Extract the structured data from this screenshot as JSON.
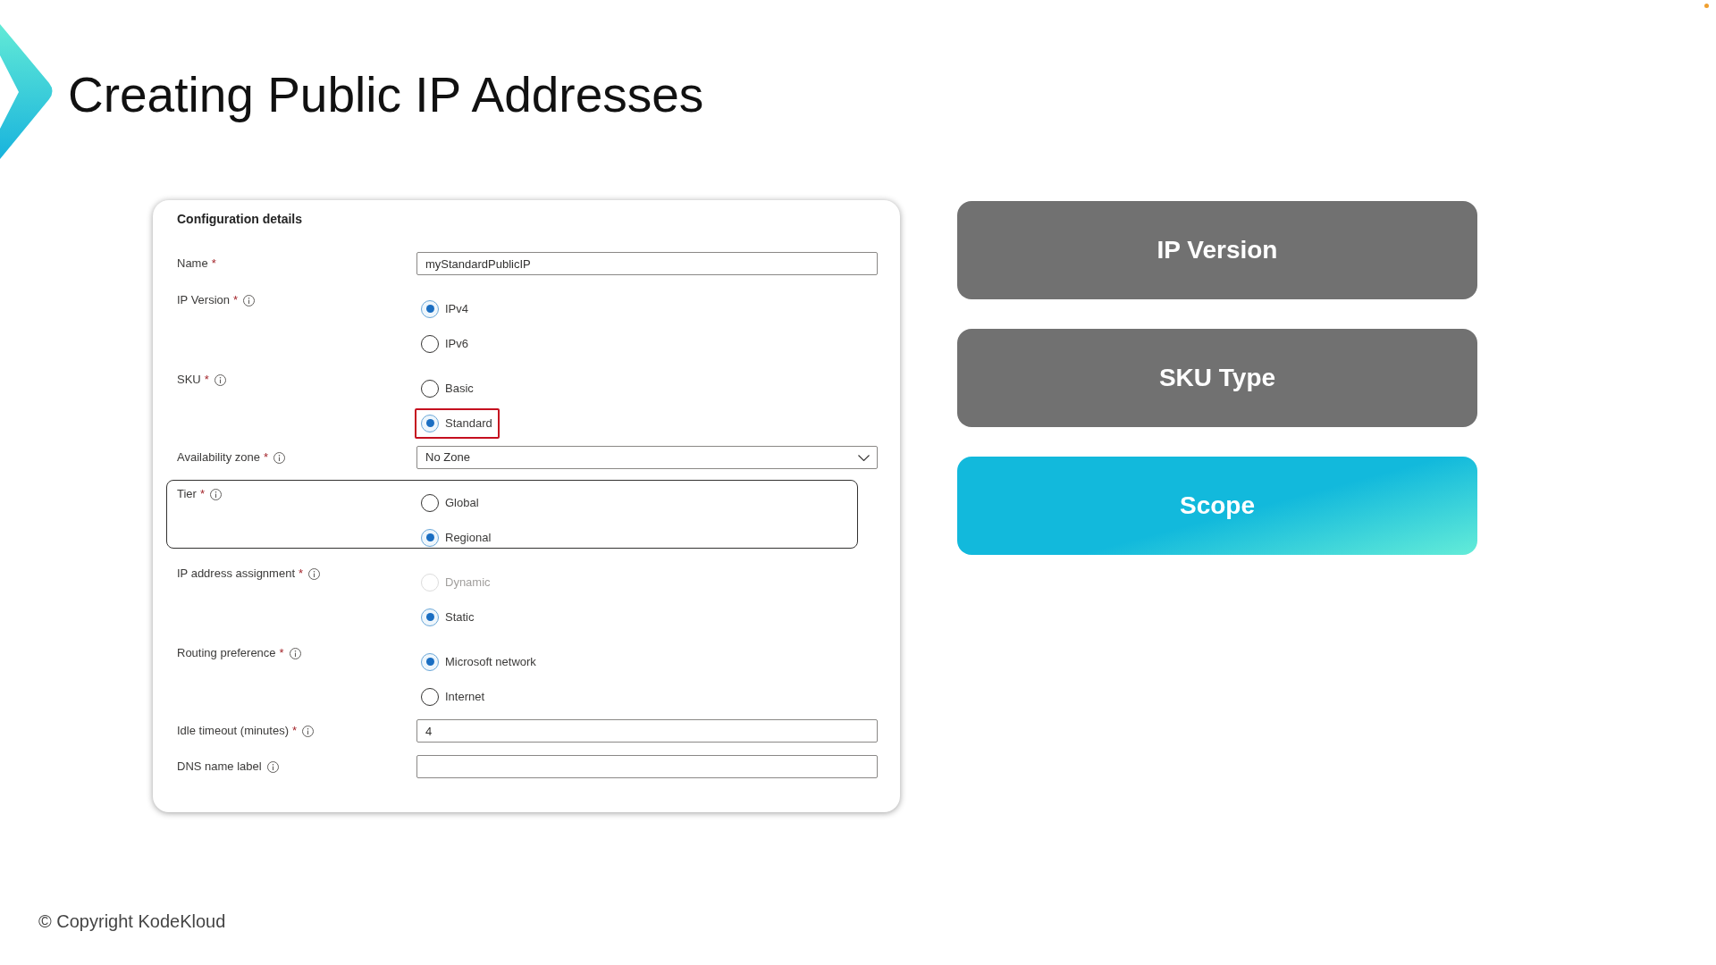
{
  "slide": {
    "title": "Creating Public IP Addresses"
  },
  "form": {
    "heading": "Configuration details",
    "fields": [
      {
        "kind": "text",
        "label": "Name",
        "required_mark": "*",
        "info": false,
        "outlined": false,
        "value": "myStandardPublicIP"
      },
      {
        "kind": "radio",
        "label": "IP Version",
        "required_mark": "*",
        "info": true,
        "outlined": false,
        "options": [
          {
            "label": "IPv4",
            "selected": true,
            "disabled": false,
            "outlined": false
          },
          {
            "label": "IPv6",
            "selected": false,
            "disabled": false,
            "outlined": false
          }
        ]
      },
      {
        "kind": "radio",
        "label": "SKU",
        "required_mark": "*",
        "info": true,
        "outlined": false,
        "options": [
          {
            "label": "Basic",
            "selected": false,
            "disabled": false,
            "outlined": false
          },
          {
            "label": "Standard",
            "selected": true,
            "disabled": false,
            "outlined": true
          }
        ]
      },
      {
        "kind": "select",
        "label": "Availability zone",
        "required_mark": "*",
        "info": true,
        "outlined": false,
        "value": "No Zone"
      },
      {
        "kind": "radio",
        "label": "Tier",
        "required_mark": "*",
        "info": true,
        "outlined": true,
        "options": [
          {
            "label": "Global",
            "selected": false,
            "disabled": false,
            "outlined": false
          },
          {
            "label": "Regional",
            "selected": true,
            "disabled": false,
            "outlined": false
          }
        ]
      },
      {
        "kind": "radio",
        "label": "IP address assignment",
        "required_mark": "*",
        "info": true,
        "outlined": false,
        "options": [
          {
            "label": "Dynamic",
            "selected": false,
            "disabled": true,
            "outlined": false
          },
          {
            "label": "Static",
            "selected": true,
            "disabled": false,
            "outlined": false
          }
        ]
      },
      {
        "kind": "radio",
        "label": "Routing preference",
        "required_mark": "*",
        "info": true,
        "outlined": false,
        "options": [
          {
            "label": "Microsoft network",
            "selected": true,
            "disabled": false,
            "outlined": false
          },
          {
            "label": "Internet",
            "selected": false,
            "disabled": false,
            "outlined": false
          }
        ]
      },
      {
        "kind": "text",
        "label": "Idle timeout (minutes)",
        "required_mark": "*",
        "info": true,
        "outlined": false,
        "value": "4"
      },
      {
        "kind": "text",
        "label": "DNS name label",
        "info": true,
        "outlined": false
      }
    ]
  },
  "topics": [
    {
      "label": "IP Version",
      "selected": false
    },
    {
      "label": "SKU Type",
      "selected": false
    },
    {
      "label": "Scope",
      "selected": true
    }
  ],
  "footer": {
    "copyright": "© Copyright KodeKloud"
  }
}
